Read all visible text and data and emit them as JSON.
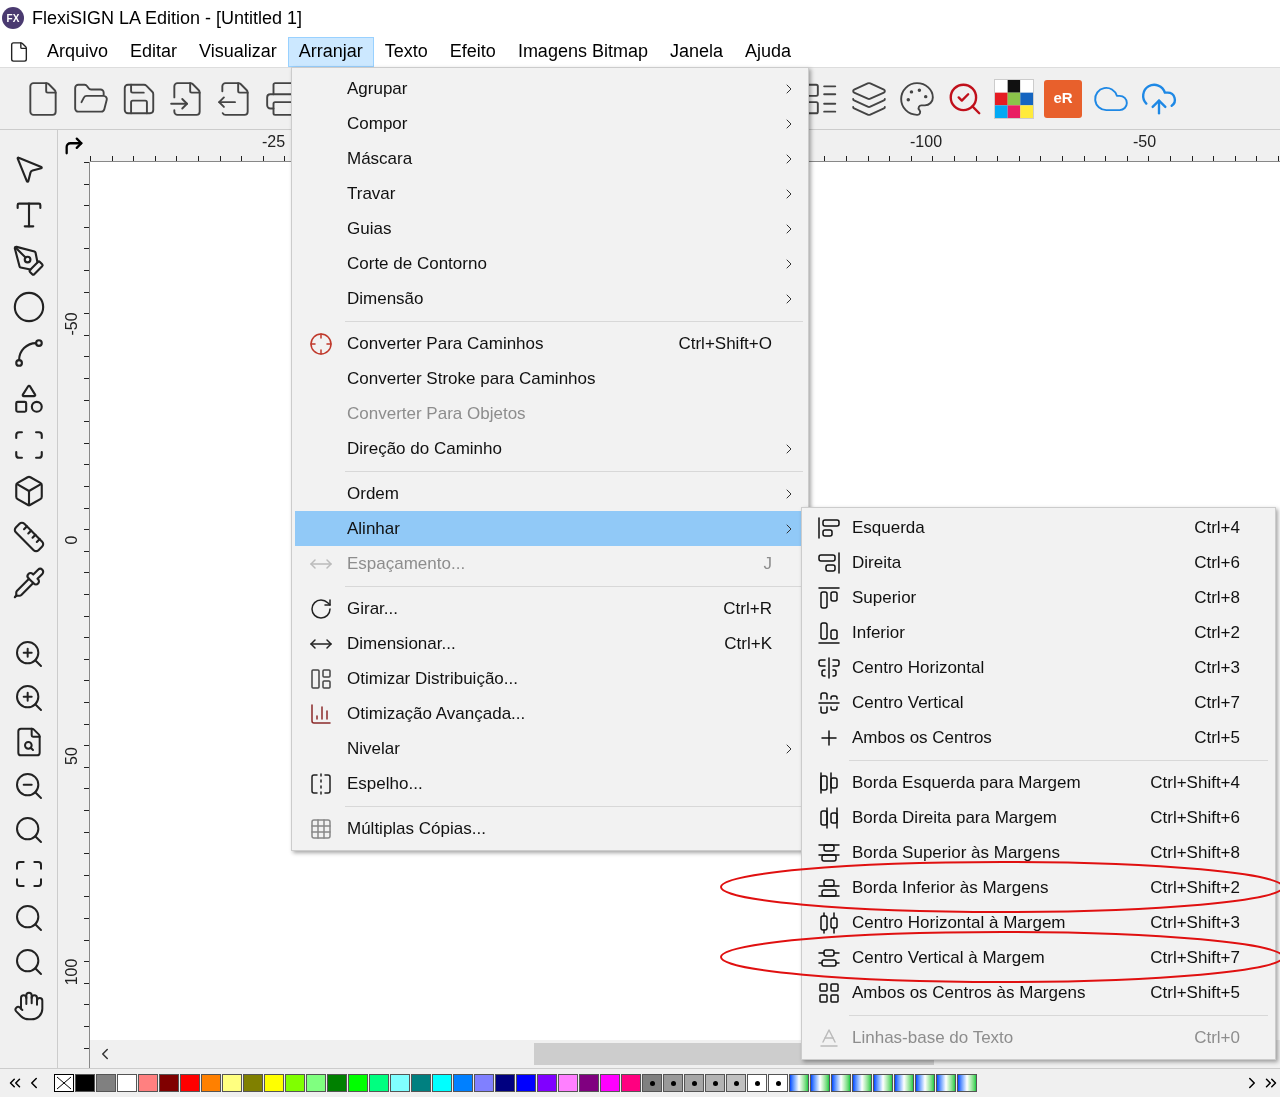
{
  "window": {
    "title": "FlexiSIGN LA Edition - [Untitled 1]",
    "app_badge": "FX"
  },
  "menu_bar": [
    {
      "label": "Arquivo",
      "selected": false
    },
    {
      "label": "Editar",
      "selected": false
    },
    {
      "label": "Visualizar",
      "selected": false
    },
    {
      "label": "Arranjar",
      "selected": true
    },
    {
      "label": "Texto",
      "selected": false
    },
    {
      "label": "Efeito",
      "selected": false
    },
    {
      "label": "Imagens Bitmap",
      "selected": false
    },
    {
      "label": "Janela",
      "selected": false
    },
    {
      "label": "Ajuda",
      "selected": false
    }
  ],
  "toolbar": {
    "logo_text": "eR"
  },
  "ruler": {
    "horizontal_labels": [
      "-25",
      "-100",
      "-50"
    ],
    "vertical_labels": [
      "-50",
      "0",
      "50",
      "100"
    ]
  },
  "dropdown": {
    "items": [
      {
        "kind": "item",
        "label": "Agrupar",
        "submenu": true,
        "disabled": false,
        "selected": false
      },
      {
        "kind": "item",
        "label": "Compor",
        "submenu": true,
        "disabled": false,
        "selected": false
      },
      {
        "kind": "item",
        "label": "Máscara",
        "submenu": true,
        "disabled": false,
        "selected": false
      },
      {
        "kind": "item",
        "label": "Travar",
        "submenu": true,
        "disabled": false,
        "selected": false
      },
      {
        "kind": "item",
        "label": "Guias",
        "submenu": true,
        "disabled": false,
        "selected": false
      },
      {
        "kind": "item",
        "label": "Corte de Contorno",
        "submenu": true,
        "disabled": false,
        "selected": false
      },
      {
        "kind": "item",
        "label": "Dimensão",
        "submenu": true,
        "disabled": false,
        "selected": false
      },
      {
        "kind": "separator"
      },
      {
        "kind": "item",
        "label": "Converter Para Caminhos",
        "shortcut": "Ctrl+Shift+O",
        "submenu": false,
        "disabled": false,
        "selected": false
      },
      {
        "kind": "item",
        "label": "Converter Stroke para Caminhos",
        "submenu": false,
        "disabled": false,
        "selected": false
      },
      {
        "kind": "item",
        "label": "Converter Para Objetos",
        "submenu": false,
        "disabled": true,
        "selected": false
      },
      {
        "kind": "item",
        "label": "Direção do Caminho",
        "submenu": true,
        "disabled": false,
        "selected": false
      },
      {
        "kind": "separator"
      },
      {
        "kind": "item",
        "label": "Ordem",
        "submenu": true,
        "disabled": false,
        "selected": false
      },
      {
        "kind": "item",
        "label": "Alinhar",
        "submenu": true,
        "disabled": false,
        "selected": true
      },
      {
        "kind": "item",
        "label": "Espaçamento...",
        "shortcut": "J",
        "submenu": false,
        "disabled": true,
        "selected": false
      },
      {
        "kind": "separator"
      },
      {
        "kind": "item",
        "label": "Girar...",
        "shortcut": "Ctrl+R",
        "submenu": false,
        "disabled": false,
        "selected": false
      },
      {
        "kind": "item",
        "label": "Dimensionar...",
        "shortcut": "Ctrl+K",
        "submenu": false,
        "disabled": false,
        "selected": false
      },
      {
        "kind": "item",
        "label": "Otimizar Distribuição...",
        "submenu": false,
        "disabled": false,
        "selected": false
      },
      {
        "kind": "item",
        "label": "Otimização Avançada...",
        "submenu": false,
        "disabled": false,
        "selected": false
      },
      {
        "kind": "item",
        "label": "Nivelar",
        "submenu": true,
        "disabled": false,
        "selected": false
      },
      {
        "kind": "item",
        "label": "Espelho...",
        "submenu": false,
        "disabled": false,
        "selected": false
      },
      {
        "kind": "separator"
      },
      {
        "kind": "item",
        "label": "Múltiplas Cópias...",
        "submenu": false,
        "disabled": false,
        "selected": false
      }
    ]
  },
  "submenu": {
    "items": [
      {
        "kind": "item",
        "label": "Esquerda",
        "shortcut": "Ctrl+4",
        "disabled": false,
        "annotated": false
      },
      {
        "kind": "item",
        "label": "Direita",
        "shortcut": "Ctrl+6",
        "disabled": false,
        "annotated": false
      },
      {
        "kind": "item",
        "label": "Superior",
        "shortcut": "Ctrl+8",
        "disabled": false,
        "annotated": false
      },
      {
        "kind": "item",
        "label": "Inferior",
        "shortcut": "Ctrl+2",
        "disabled": false,
        "annotated": false
      },
      {
        "kind": "item",
        "label": "Centro Horizontal",
        "shortcut": "Ctrl+3",
        "disabled": false,
        "annotated": false
      },
      {
        "kind": "item",
        "label": "Centro Vertical",
        "shortcut": "Ctrl+7",
        "disabled": false,
        "annotated": false
      },
      {
        "kind": "item",
        "label": "Ambos os Centros",
        "shortcut": "Ctrl+5",
        "disabled": false,
        "annotated": false
      },
      {
        "kind": "separator"
      },
      {
        "kind": "item",
        "label": "Borda Esquerda para Margem",
        "shortcut": "Ctrl+Shift+4",
        "disabled": false,
        "annotated": false
      },
      {
        "kind": "item",
        "label": "Borda Direita para Margem",
        "shortcut": "Ctrl+Shift+6",
        "disabled": false,
        "annotated": false
      },
      {
        "kind": "item",
        "label": "Borda Superior às Margens",
        "shortcut": "Ctrl+Shift+8",
        "disabled": false,
        "annotated": false
      },
      {
        "kind": "item",
        "label": "Borda Inferior às Margens",
        "shortcut": "Ctrl+Shift+2",
        "disabled": false,
        "annotated": true
      },
      {
        "kind": "item",
        "label": "Centro Horizontal à Margem",
        "shortcut": "Ctrl+Shift+3",
        "disabled": false,
        "annotated": false
      },
      {
        "kind": "item",
        "label": "Centro Vertical à Margem",
        "shortcut": "Ctrl+Shift+7",
        "disabled": false,
        "annotated": true
      },
      {
        "kind": "item",
        "label": "Ambos os Centros às Margens",
        "shortcut": "Ctrl+Shift+5",
        "disabled": false,
        "annotated": false
      },
      {
        "kind": "separator"
      },
      {
        "kind": "item",
        "label": "Linhas-base do Texto",
        "shortcut": "Ctrl+0",
        "disabled": true,
        "annotated": false
      }
    ]
  },
  "palette": [
    {
      "kind": "none"
    },
    {
      "kind": "solid",
      "color": "#000000"
    },
    {
      "kind": "solid",
      "color": "#808080"
    },
    {
      "kind": "solid",
      "color": "#ffffff"
    },
    {
      "kind": "solid",
      "color": "#ff8080"
    },
    {
      "kind": "solid",
      "color": "#800000"
    },
    {
      "kind": "solid",
      "color": "#ff0000"
    },
    {
      "kind": "solid",
      "color": "#ff8000"
    },
    {
      "kind": "solid",
      "color": "#ffff80"
    },
    {
      "kind": "solid",
      "color": "#808000"
    },
    {
      "kind": "solid",
      "color": "#ffff00"
    },
    {
      "kind": "solid",
      "color": "#80ff00"
    },
    {
      "kind": "solid",
      "color": "#80ff80"
    },
    {
      "kind": "solid",
      "color": "#008000"
    },
    {
      "kind": "solid",
      "color": "#00ff00"
    },
    {
      "kind": "solid",
      "color": "#00ff80"
    },
    {
      "kind": "solid",
      "color": "#80ffff"
    },
    {
      "kind": "solid",
      "color": "#008080"
    },
    {
      "kind": "solid",
      "color": "#00ffff"
    },
    {
      "kind": "solid",
      "color": "#0080ff"
    },
    {
      "kind": "solid",
      "color": "#8080ff"
    },
    {
      "kind": "solid",
      "color": "#000080"
    },
    {
      "kind": "solid",
      "color": "#0000ff"
    },
    {
      "kind": "solid",
      "color": "#8000ff"
    },
    {
      "kind": "solid",
      "color": "#ff80ff"
    },
    {
      "kind": "solid",
      "color": "#800080"
    },
    {
      "kind": "solid",
      "color": "#ff00ff"
    },
    {
      "kind": "solid",
      "color": "#ff0080"
    },
    {
      "kind": "tint",
      "color": "#808080"
    },
    {
      "kind": "tint",
      "color": "#999999"
    },
    {
      "kind": "tint",
      "color": "#a6a6a6"
    },
    {
      "kind": "tint",
      "color": "#b3b3b3"
    },
    {
      "kind": "tint",
      "color": "#c0c0c0"
    },
    {
      "kind": "tint",
      "color": "#ffffff"
    },
    {
      "kind": "tint",
      "color": "#ffffff"
    },
    {
      "kind": "special"
    },
    {
      "kind": "special"
    },
    {
      "kind": "special"
    },
    {
      "kind": "special"
    },
    {
      "kind": "special"
    },
    {
      "kind": "special"
    },
    {
      "kind": "special"
    },
    {
      "kind": "special"
    },
    {
      "kind": "special"
    }
  ]
}
